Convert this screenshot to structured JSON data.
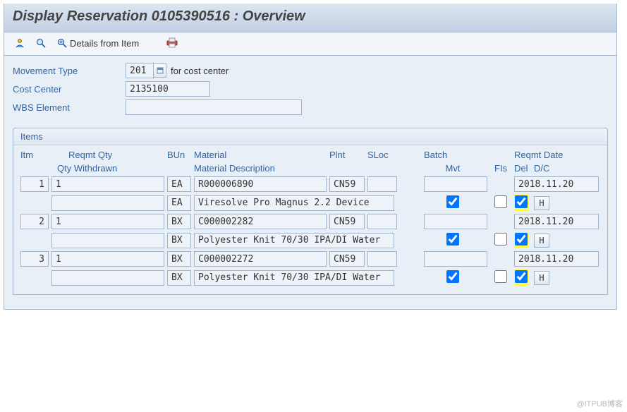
{
  "window": {
    "title": "Display Reservation 0105390516 : Overview"
  },
  "toolbar": {
    "details_label": "Details from Item"
  },
  "form": {
    "movement_type_label": "Movement Type",
    "movement_type_value": "201",
    "movement_type_text": "for cost center",
    "cost_center_label": "Cost Center",
    "cost_center_value": "2135100",
    "wbs_label": "WBS Element",
    "wbs_value": ""
  },
  "items": {
    "group_title": "Items",
    "headers1": {
      "itm": "Itm",
      "reqmt_qty": "Reqmt Qty",
      "bun": "BUn",
      "material": "Material",
      "plnt": "Plnt",
      "sloc": "SLoc",
      "batch": "Batch",
      "reqmt_date": "Reqmt Date"
    },
    "headers2": {
      "qty_withdrawn": "Qty Withdrawn",
      "material_desc": "Material Description",
      "mvt": "Mvt",
      "fis": "FIs",
      "del": "Del",
      "dc": "D/C"
    },
    "rows": [
      {
        "itm": "1",
        "qty": "1",
        "bun": "EA",
        "material": "R000006890",
        "plnt": "CN59",
        "sloc": "",
        "batch": "",
        "reqmt_date": "2018.11.20",
        "withdrawn": "",
        "bun2": "EA",
        "desc": "Viresolve Pro Magnus 2.2 Device",
        "mvt": true,
        "fis": false,
        "del": true,
        "del_hl": true,
        "dc": "H"
      },
      {
        "itm": "2",
        "qty": "1",
        "bun": "BX",
        "material": "C000002282",
        "plnt": "CN59",
        "sloc": "",
        "batch": "",
        "reqmt_date": "2018.11.20",
        "withdrawn": "",
        "bun2": "BX",
        "desc": "Polyester Knit 70/30 IPA/DI Water",
        "mvt": true,
        "fis": false,
        "del": true,
        "del_hl": true,
        "dc": "H"
      },
      {
        "itm": "3",
        "qty": "1",
        "bun": "BX",
        "material": "C000002272",
        "plnt": "CN59",
        "sloc": "",
        "batch": "",
        "reqmt_date": "2018.11.20",
        "withdrawn": "",
        "bun2": "BX",
        "desc": "Polyester Knit 70/30 IPA/DI Water",
        "mvt": true,
        "fis": false,
        "del": true,
        "del_hl": true,
        "dc": "H"
      }
    ]
  },
  "watermark": "@ITPUB博客"
}
